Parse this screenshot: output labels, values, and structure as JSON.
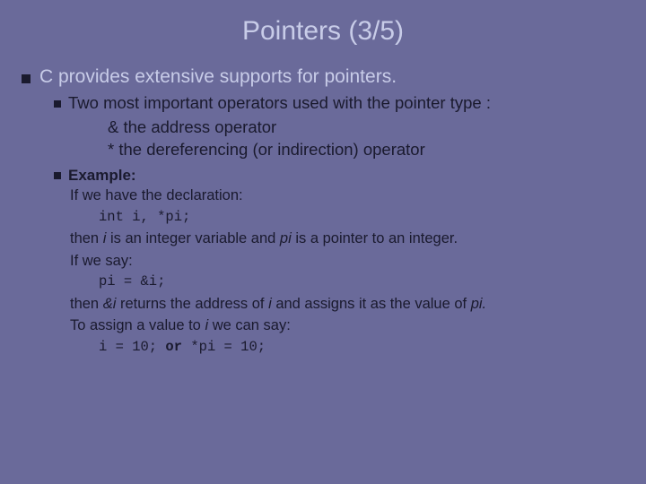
{
  "title": "Pointers (3/5)",
  "main_point": "C provides extensive supports for pointers.",
  "sub_point": "Two most important operators used with the pointer type :",
  "op1_sym": "&",
  "op1_txt": " the address operator",
  "op2_sym": "*",
  "op2_txt": "  the dereferencing (or indirection) operator",
  "example_label": "Example:",
  "ex_line1": "If we have the declaration:",
  "ex_code1": "int i, *pi;",
  "ex_line2a": "then ",
  "ex_line2_i1": "i",
  "ex_line2b": " is an integer variable and ",
  "ex_line2_i2": "pi",
  "ex_line2c": " is a pointer to an integer.",
  "ex_line3": "If we say:",
  "ex_code2": "pi = &i;",
  "ex_line4a": "then ",
  "ex_line4_i1": "&i",
  "ex_line4b": " returns the address of ",
  "ex_line4_i2": "i",
  "ex_line4c": " and assigns it as the value of ",
  "ex_line4_i3": "pi.",
  "ex_line5a": "To assign a value to ",
  "ex_line5_i1": "i",
  "ex_line5b": " we can say:",
  "ex_code3a": "i = 10;",
  "ex_code3_or": " or ",
  "ex_code3b": "*pi = 10;"
}
